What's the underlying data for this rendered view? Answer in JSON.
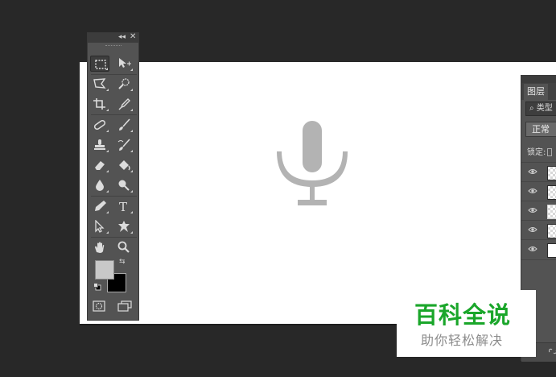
{
  "tools_panel": {
    "collapse_glyph": "◂◂",
    "close_glyph": "✕",
    "tools": [
      {
        "name": "rectangular-marquee-tool",
        "icon": "marquee-icon",
        "active": true
      },
      {
        "name": "move-tool",
        "icon": "move-icon"
      },
      {
        "name": "lasso-tool",
        "icon": "polygonal-lasso-icon"
      },
      {
        "name": "quick-selection-tool",
        "icon": "quick-selection-icon"
      },
      {
        "name": "crop-tool",
        "icon": "crop-icon"
      },
      {
        "name": "eyedropper-tool",
        "icon": "eyedropper-icon"
      },
      {
        "name": "healing-brush-tool",
        "icon": "bandage-icon"
      },
      {
        "name": "brush-tool",
        "icon": "brush-icon"
      },
      {
        "name": "clone-stamp-tool",
        "icon": "stamp-icon"
      },
      {
        "name": "history-brush-tool",
        "icon": "history-brush-icon"
      },
      {
        "name": "eraser-tool",
        "icon": "eraser-icon"
      },
      {
        "name": "paint-bucket-tool",
        "icon": "bucket-icon"
      },
      {
        "name": "blur-tool",
        "icon": "drop-icon"
      },
      {
        "name": "dodge-tool",
        "icon": "dodge-icon"
      },
      {
        "name": "pen-tool",
        "icon": "pen-icon"
      },
      {
        "name": "type-tool",
        "icon": "type-icon",
        "label": "T"
      },
      {
        "name": "path-selection-tool",
        "icon": "arrow-icon"
      },
      {
        "name": "custom-shape-tool",
        "icon": "shape-icon"
      },
      {
        "name": "hand-tool",
        "icon": "hand-icon"
      },
      {
        "name": "zoom-tool",
        "icon": "magnifier-icon"
      }
    ],
    "foreground_color": "#c8c8c8",
    "background_color": "#000000",
    "swap_glyph": "⇆"
  },
  "canvas": {
    "background": "#ffffff",
    "center_icon": "microphone-icon",
    "icon_color": "#b3b3b3"
  },
  "layers_panel": {
    "tab_label": "图层",
    "filter_label": "类型",
    "blend_mode": "正常",
    "lock_label": "锁定:",
    "layers": [
      {
        "visible": true,
        "thumb": "transparent"
      },
      {
        "visible": true,
        "thumb": "transparent"
      },
      {
        "visible": true,
        "thumb": "transparent",
        "selected": true
      },
      {
        "visible": true,
        "thumb": "transparent"
      },
      {
        "visible": true,
        "thumb": "white"
      }
    ]
  },
  "watermark": {
    "main": "百科全说",
    "sub": "助你轻松解决"
  }
}
